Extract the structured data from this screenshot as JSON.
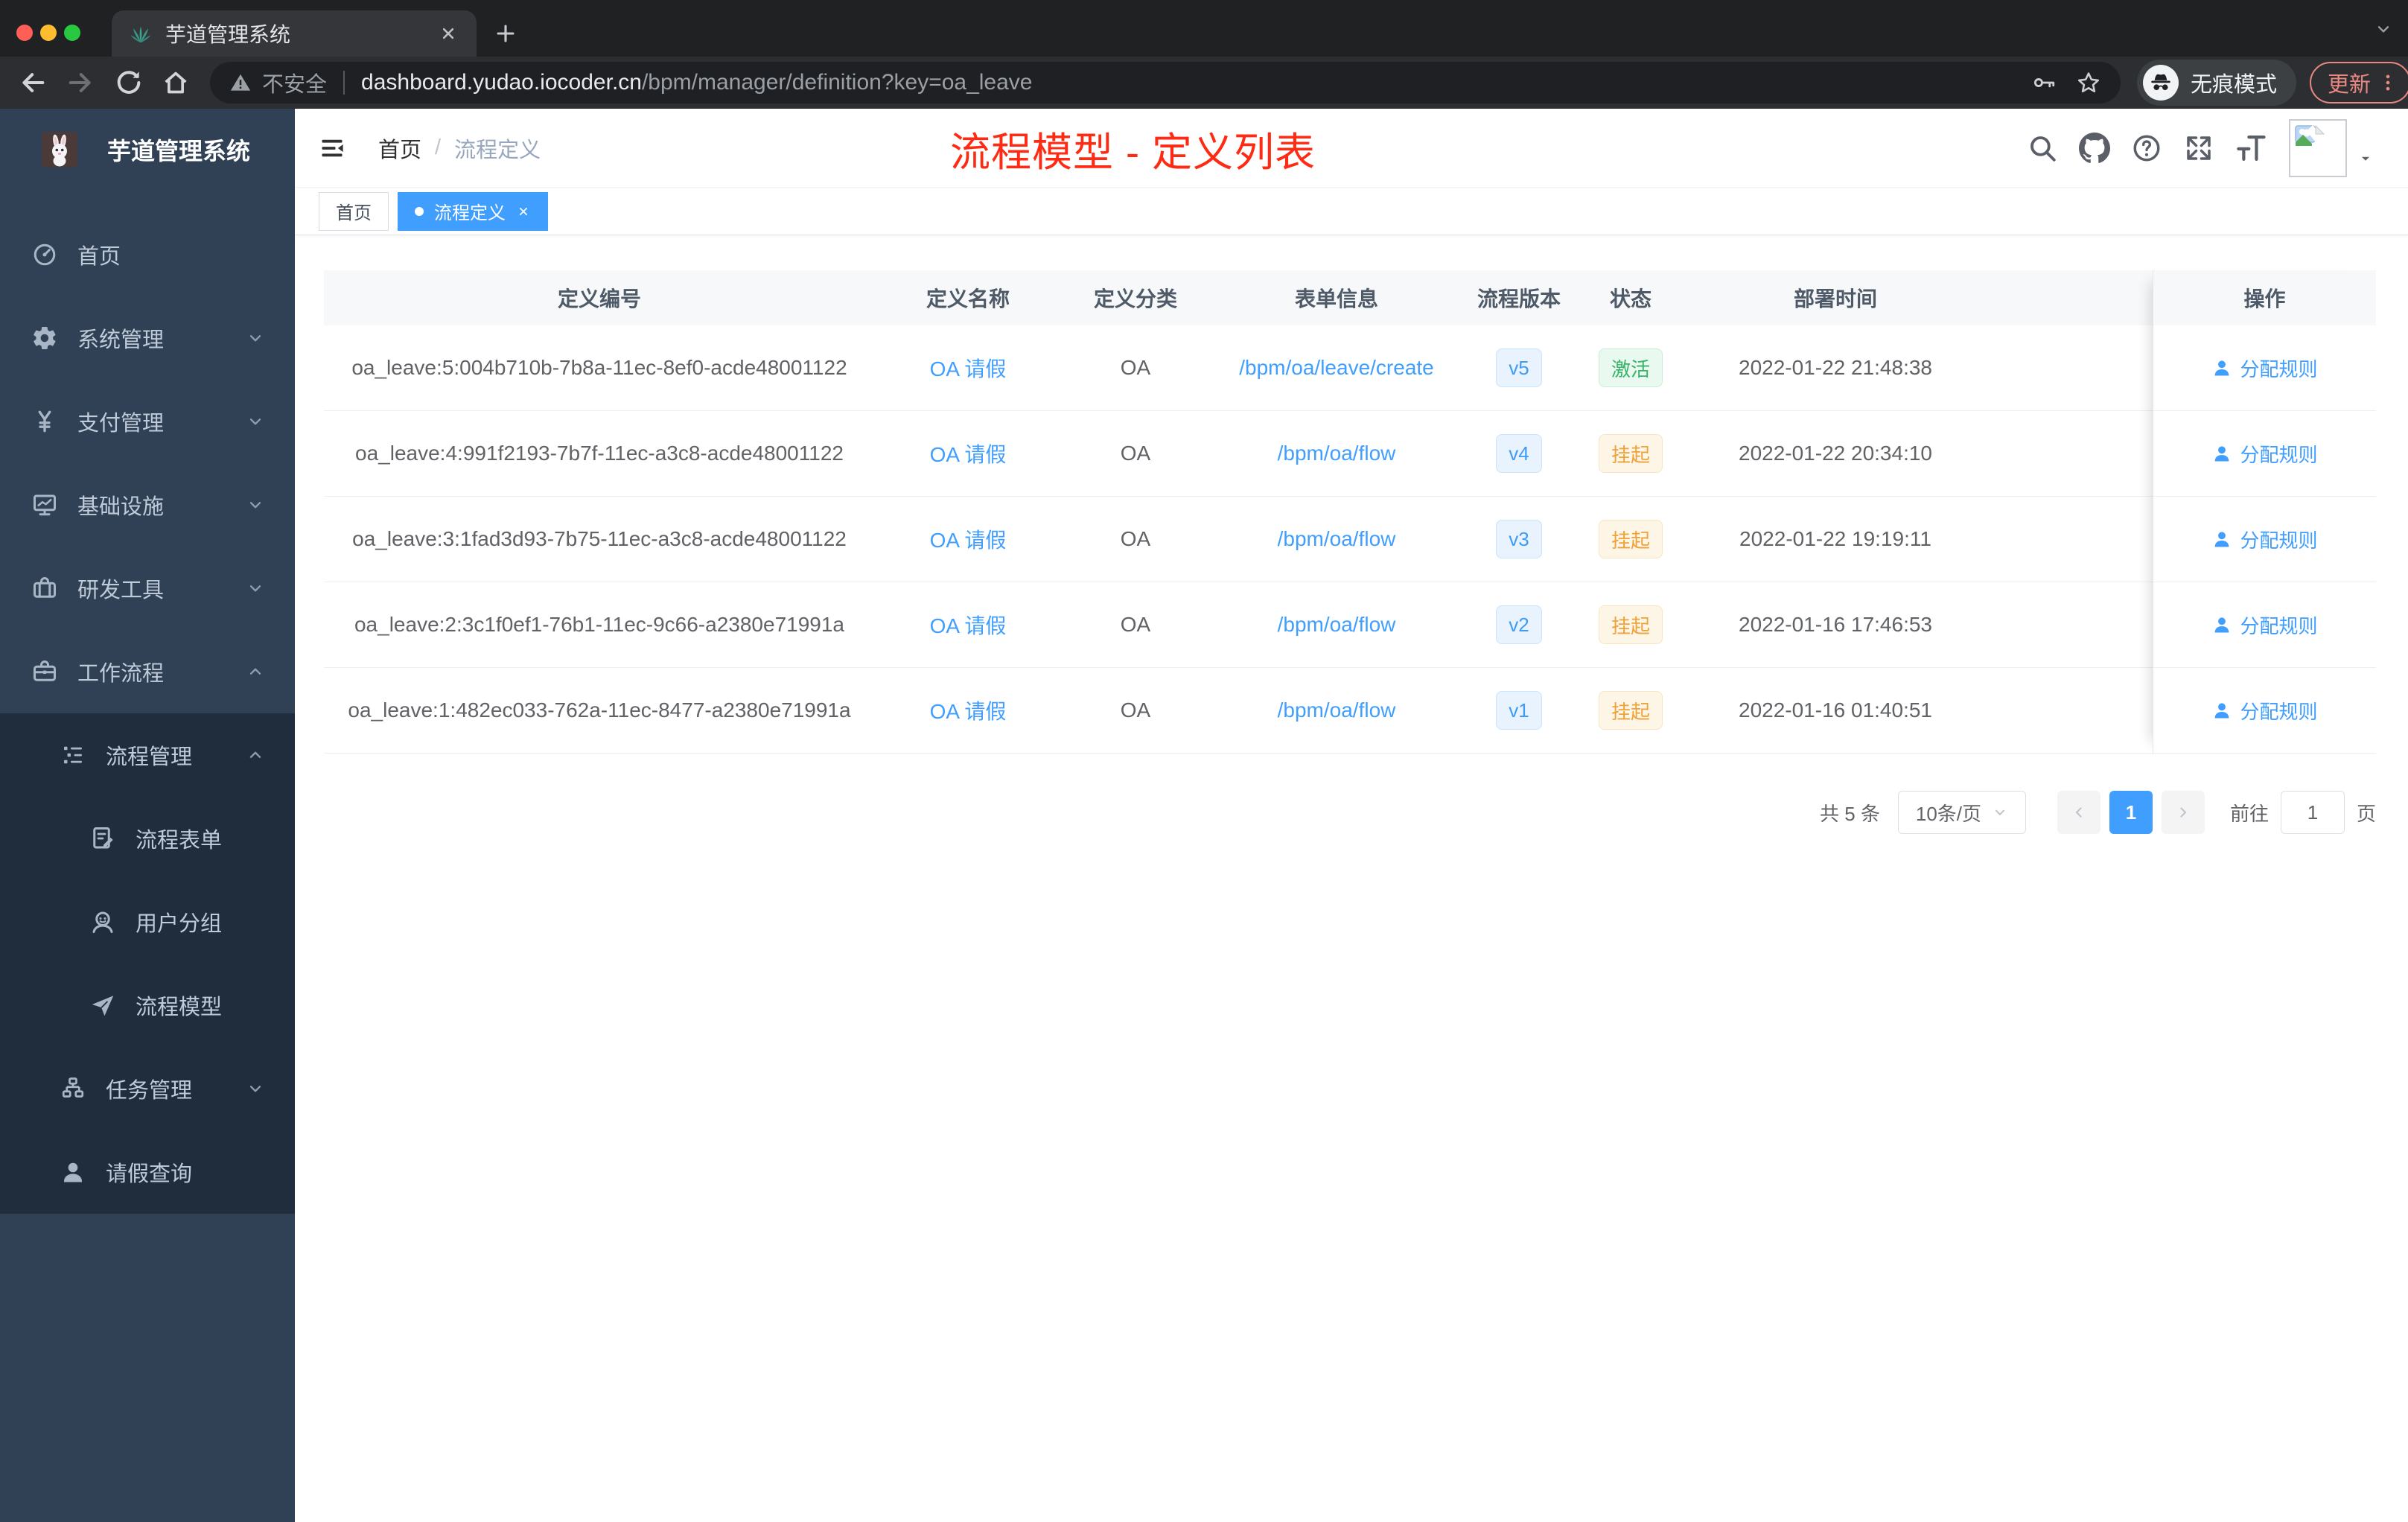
{
  "colors": {
    "accent_blue": "#409eff",
    "annotation_red": "#fe2b14",
    "status_active_green": "#36b368",
    "status_suspend_orange": "#efa23a",
    "sidebar_bg": "#304156",
    "submenu_bg": "#1f2d3d",
    "update_button_red": "#e98880"
  },
  "browser": {
    "tab_title": "芋道管理系统",
    "security_label": "不安全",
    "url_domain": "dashboard.yudao.iocoder.cn",
    "url_path": "/bpm/manager/definition?key=oa_leave",
    "incognito_label": "无痕模式",
    "update_label": "更新"
  },
  "sidebar": {
    "logo_title": "芋道管理系统",
    "menu_top": [
      {
        "key": "home",
        "label": "首页",
        "icon": "dashboard-icon",
        "symbol": "i-dashboard",
        "arrow": "",
        "level": 1
      },
      {
        "key": "system-management",
        "label": "系统管理",
        "icon": "gear-icon",
        "symbol": "i-gear",
        "arrow": "down",
        "level": 1
      },
      {
        "key": "payment-management",
        "label": "支付管理",
        "icon": "yen-icon",
        "symbol": "i-yen",
        "arrow": "down",
        "level": 1
      },
      {
        "key": "infrastructure",
        "label": "基础设施",
        "icon": "monitor-icon",
        "symbol": "i-monitor",
        "arrow": "down",
        "level": 1
      },
      {
        "key": "dev-tools",
        "label": "研发工具",
        "icon": "toolbox-icon",
        "symbol": "i-toolbox",
        "arrow": "down",
        "level": 1
      },
      {
        "key": "workflow",
        "label": "工作流程",
        "icon": "briefcase-icon",
        "symbol": "i-briefcase",
        "arrow": "up",
        "level": 1
      }
    ],
    "menu_sub": [
      {
        "key": "process-management",
        "label": "流程管理",
        "icon": "list-tree-icon",
        "symbol": "i-listtree",
        "arrow": "up",
        "level": 2
      },
      {
        "key": "process-form",
        "label": "流程表单",
        "icon": "form-edit-icon",
        "symbol": "i-docedit",
        "arrow": "",
        "level": 3
      },
      {
        "key": "user-group",
        "label": "用户分组",
        "icon": "user-group-icon",
        "symbol": "i-group",
        "arrow": "",
        "level": 3
      },
      {
        "key": "process-model",
        "label": "流程模型",
        "icon": "paper-plane-icon",
        "symbol": "i-plane",
        "arrow": "",
        "level": 3
      },
      {
        "key": "task-management",
        "label": "任务管理",
        "icon": "org-tree-icon",
        "symbol": "i-orgtree",
        "arrow": "down",
        "level": 2
      },
      {
        "key": "leave-query",
        "label": "请假查询",
        "icon": "person-icon",
        "symbol": "i-user",
        "arrow": "",
        "level": 2
      }
    ]
  },
  "navbar": {
    "breadcrumb_home": "首页",
    "breadcrumb_sep": "/",
    "breadcrumb_current": "流程定义",
    "annotation": "流程模型 - 定义列表"
  },
  "tags": [
    {
      "label": "首页",
      "active": false,
      "closable": false
    },
    {
      "label": "流程定义",
      "active": true,
      "closable": true
    }
  ],
  "table": {
    "columns": [
      "定义编号",
      "定义名称",
      "定义分类",
      "表单信息",
      "流程版本",
      "状态",
      "部署时间"
    ],
    "action_column": "操作",
    "action_label": "分配规则",
    "rows": [
      {
        "id": "oa_leave:5:004b710b-7b8a-11ec-8ef0-acde48001122",
        "name": "OA 请假",
        "category": "OA",
        "form": "/bpm/oa/leave/create",
        "version": "v5",
        "status": "激活",
        "status_type": "success",
        "deployed_at": "2022-01-22 21:48:38"
      },
      {
        "id": "oa_leave:4:991f2193-7b7f-11ec-a3c8-acde48001122",
        "name": "OA 请假",
        "category": "OA",
        "form": "/bpm/oa/flow",
        "version": "v4",
        "status": "挂起",
        "status_type": "warning",
        "deployed_at": "2022-01-22 20:34:10"
      },
      {
        "id": "oa_leave:3:1fad3d93-7b75-11ec-a3c8-acde48001122",
        "name": "OA 请假",
        "category": "OA",
        "form": "/bpm/oa/flow",
        "version": "v3",
        "status": "挂起",
        "status_type": "warning",
        "deployed_at": "2022-01-22 19:19:11"
      },
      {
        "id": "oa_leave:2:3c1f0ef1-76b1-11ec-9c66-a2380e71991a",
        "name": "OA 请假",
        "category": "OA",
        "form": "/bpm/oa/flow",
        "version": "v2",
        "status": "挂起",
        "status_type": "warning",
        "deployed_at": "2022-01-16 17:46:53"
      },
      {
        "id": "oa_leave:1:482ec033-762a-11ec-8477-a2380e71991a",
        "name": "OA 请假",
        "category": "OA",
        "form": "/bpm/oa/flow",
        "version": "v1",
        "status": "挂起",
        "status_type": "warning",
        "deployed_at": "2022-01-16 01:40:51"
      }
    ]
  },
  "pagination": {
    "total_label": "共 5 条",
    "page_size": "10条/页",
    "current_page": "1",
    "goto_label": "前往",
    "goto_value": "1",
    "page_unit": "页"
  }
}
